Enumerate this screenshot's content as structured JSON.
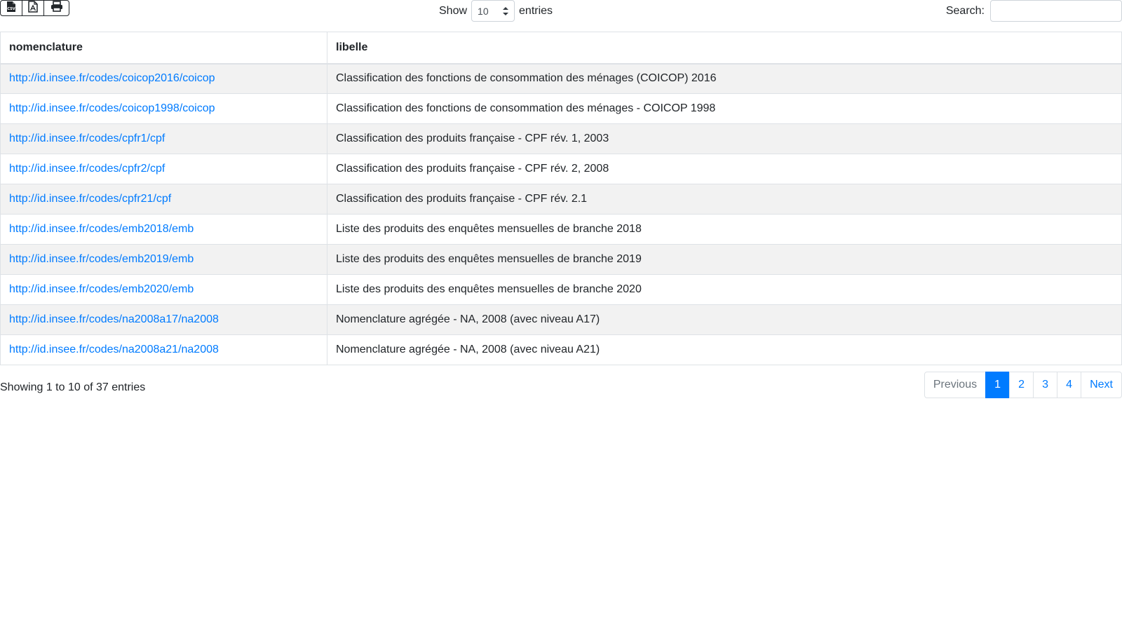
{
  "toolbar": {
    "export_buttons": [
      {
        "name": "csv",
        "icon": "csv-file-icon",
        "glyph": "CSV"
      },
      {
        "name": "pdf",
        "icon": "pdf-file-icon"
      },
      {
        "name": "print",
        "icon": "print-icon"
      }
    ],
    "show_label": "Show",
    "page_length": "10",
    "entries_label": "entries",
    "search_label": "Search:",
    "search_value": ""
  },
  "table": {
    "columns": [
      "nomenclature",
      "libelle"
    ],
    "rows": [
      {
        "nomenclature": "http://id.insee.fr/codes/coicop2016/coicop",
        "libelle": "Classification des fonctions de consommation des ménages (COICOP) 2016"
      },
      {
        "nomenclature": "http://id.insee.fr/codes/coicop1998/coicop",
        "libelle": "Classification des fonctions de consommation des ménages - COICOP 1998"
      },
      {
        "nomenclature": "http://id.insee.fr/codes/cpfr1/cpf",
        "libelle": "Classification des produits française - CPF rév. 1, 2003"
      },
      {
        "nomenclature": "http://id.insee.fr/codes/cpfr2/cpf",
        "libelle": "Classification des produits française - CPF rév. 2, 2008"
      },
      {
        "nomenclature": "http://id.insee.fr/codes/cpfr21/cpf",
        "libelle": "Classification des produits française - CPF rév. 2.1"
      },
      {
        "nomenclature": "http://id.insee.fr/codes/emb2018/emb",
        "libelle": "Liste des produits des enquêtes mensuelles de branche 2018"
      },
      {
        "nomenclature": "http://id.insee.fr/codes/emb2019/emb",
        "libelle": "Liste des produits des enquêtes mensuelles de branche 2019"
      },
      {
        "nomenclature": "http://id.insee.fr/codes/emb2020/emb",
        "libelle": "Liste des produits des enquêtes mensuelles de branche 2020"
      },
      {
        "nomenclature": "http://id.insee.fr/codes/na2008a17/na2008",
        "libelle": "Nomenclature agrégée - NA, 2008 (avec niveau A17)"
      },
      {
        "nomenclature": "http://id.insee.fr/codes/na2008a21/na2008",
        "libelle": "Nomenclature agrégée - NA, 2008 (avec niveau A21)"
      }
    ]
  },
  "footer": {
    "info": "Showing 1 to 10 of 37 entries",
    "pagination": {
      "previous": "Previous",
      "pages": [
        "1",
        "2",
        "3",
        "4"
      ],
      "active": "1",
      "next": "Next"
    }
  },
  "colors": {
    "link": "#007bff",
    "active_page_bg": "#007bff",
    "stripe": "#f2f2f2",
    "border": "#dee2e6"
  }
}
